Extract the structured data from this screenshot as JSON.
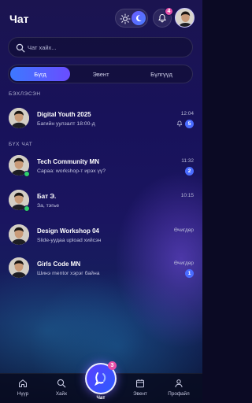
{
  "header": {
    "title": "Чат",
    "notification_count": "4"
  },
  "search": {
    "placeholder": "Чат хайх..."
  },
  "tabs": [
    {
      "label": "Бүгд",
      "active": true
    },
    {
      "label": "Эвент",
      "active": false
    },
    {
      "label": "Бүлгүүд",
      "active": false
    }
  ],
  "sections": {
    "pinned": "БЭХЛЭСЭН",
    "all": "БҮХ ЧАТ"
  },
  "pinned_chats": [
    {
      "name": "Digital Youth 2025",
      "message": "Багийн уулзалт 18:00-д",
      "time": "12:04",
      "unread": "5",
      "muted": true,
      "online": false
    }
  ],
  "chats": [
    {
      "name": "Tech Community MN",
      "message": "Сараа: workshop-т ирэх үү?",
      "time": "11:32",
      "unread": "2",
      "online": true
    },
    {
      "name": "Бат Э.",
      "message": "За, тэгье",
      "time": "10:15",
      "unread": "",
      "online": true
    },
    {
      "name": "Design Workshop 04",
      "message": "Slide-уудаа upload хийсэн",
      "time": "Өчигдөр",
      "unread": "",
      "online": false
    },
    {
      "name": "Girls Code MN",
      "message": "Шинэ mentor хэрэг байна",
      "time": "Өчигдөр",
      "unread": "1",
      "online": false
    }
  ],
  "nav": {
    "home": "Нүүр",
    "search": "Хайх",
    "chat": "Чат",
    "chat_badge": "3",
    "events": "Эвент",
    "profile": "Профайл"
  },
  "colors": {
    "accent": "#4a6cff",
    "badge": "#e64fa8",
    "online": "#2ed06a"
  }
}
